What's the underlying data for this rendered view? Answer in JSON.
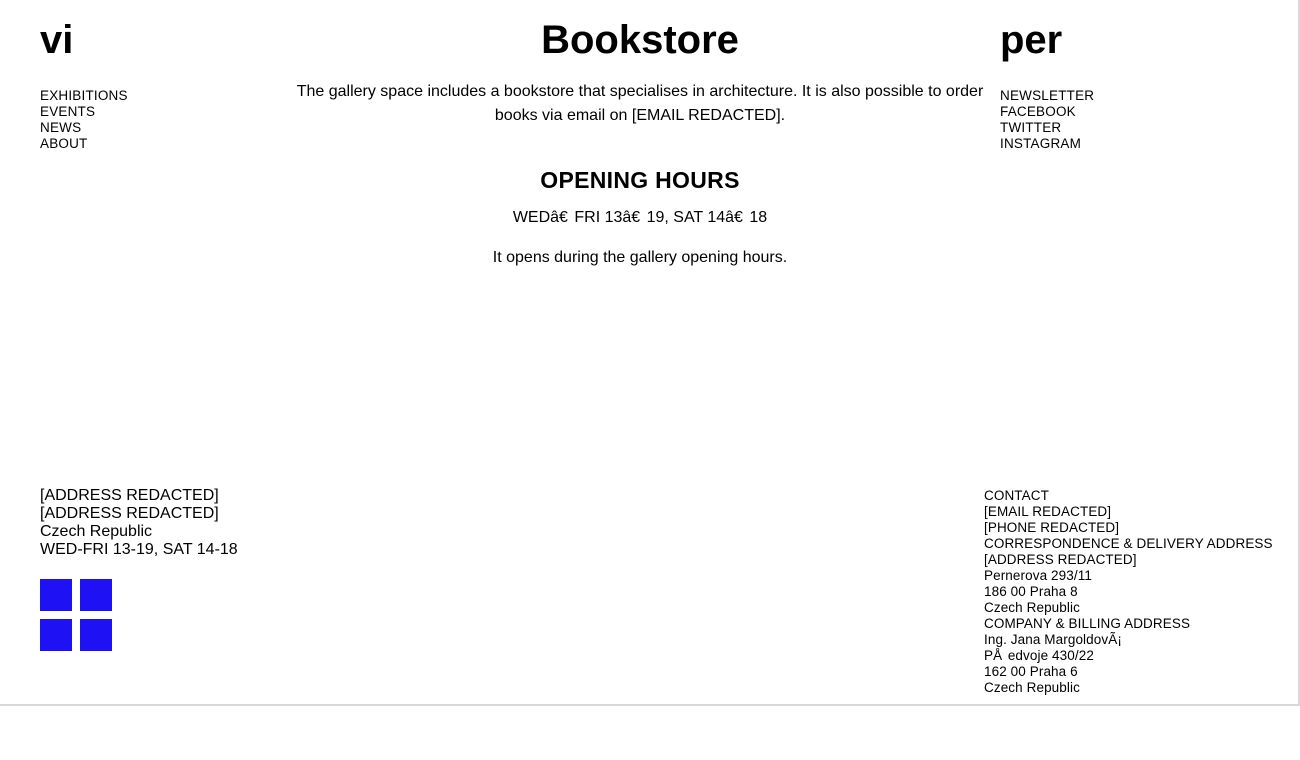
{
  "header": {
    "left_logo": "vi",
    "right_logo": "per"
  },
  "nav": {
    "items": [
      "EXHIBITIONS",
      "EVENTS",
      "NEWS",
      "ABOUT"
    ]
  },
  "social_nav": {
    "items": [
      "NEWSLETTER",
      "FACEBOOK",
      "TWITTER",
      "INSTAGRAM"
    ]
  },
  "main": {
    "title": "Bookstore",
    "intro": "The gallery space includes a bookstore that specialises in architecture. It is also possible to order books via email on [EMAIL REDACTED].",
    "opening_heading": "OPENING HOURS",
    "hours": "WEDâ€  FRI 13â€  19, SAT 14â€  18",
    "note": "It opens during the gallery opening hours."
  },
  "footer_left": {
    "lines": [
      "[ADDRESS REDACTED]",
      "[ADDRESS REDACTED]",
      "Czech Republic",
      "WED-FRI 13-19, SAT 14-18"
    ],
    "social_color": "#1e12f5",
    "social_icons": [
      "social-icon-1",
      "social-icon-2",
      "social-icon-3",
      "social-icon-4"
    ]
  },
  "footer_right": {
    "lines": [
      "CONTACT",
      "[EMAIL REDACTED]",
      "[PHONE REDACTED]",
      "CORRESPONDENCE & DELIVERY ADDRESS",
      "[ADDRESS REDACTED]",
      "Pernerova 293/11",
      "186 00 Praha 8",
      "Czech Republic",
      "COMPANY & BILLING ADDRESS",
      "Ing. Jana MargoldovÃ¡",
      "PÅ  edvoje 430/22",
      "162 00 Praha 6",
      "Czech Republic"
    ]
  }
}
